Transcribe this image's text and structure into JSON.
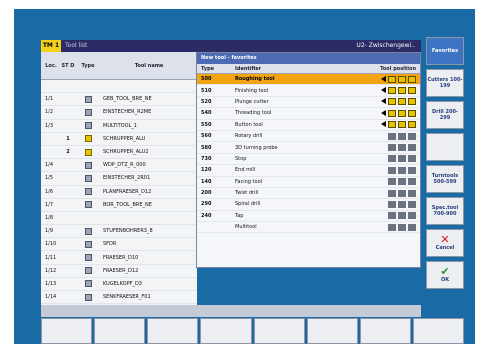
{
  "title_bar": {
    "badge": "TM 1",
    "label": "Tool list",
    "right_text": "U2- Zwischengewi.."
  },
  "main_list": {
    "headers": {
      "location": "Loc.",
      "no": "ST D",
      "type": "Type",
      "name": "Tool name"
    },
    "rows": [
      {
        "loc": "",
        "no": "",
        "type": "",
        "name": ""
      },
      {
        "loc": "1/1",
        "no": "",
        "type": "tool",
        "name": "GEB_TOOL_BRE_NE"
      },
      {
        "loc": "1/2",
        "no": "",
        "type": "tool",
        "name": "EINSTECHER_R2ME"
      },
      {
        "loc": "1/3",
        "no": "",
        "type": "tool",
        "name": "MULTITOOL_1"
      },
      {
        "loc": "",
        "no": "1",
        "type": "yellow",
        "name": "SCHRUPPER_ALU"
      },
      {
        "loc": "",
        "no": "2",
        "type": "yellow",
        "name": "SCHRUPPER_ALU2"
      },
      {
        "loc": "1/4",
        "no": "",
        "type": "tool",
        "name": "WDP_DTZ_R_000"
      },
      {
        "loc": "1/5",
        "no": "",
        "type": "tool",
        "name": "EINSTECHER_2R01"
      },
      {
        "loc": "1/6",
        "no": "",
        "type": "tool",
        "name": "PLANFRAESER_D12"
      },
      {
        "loc": "1/7",
        "no": "",
        "type": "tool",
        "name": "BOR_TOOL_BRE_NE"
      },
      {
        "loc": "1/8",
        "no": "",
        "type": "",
        "name": ""
      },
      {
        "loc": "1/9",
        "no": "",
        "type": "tool",
        "name": "STUFENBOHRER3_8"
      },
      {
        "loc": "1/10",
        "no": "",
        "type": "tool",
        "name": "SFDR"
      },
      {
        "loc": "1/11",
        "no": "",
        "type": "tool",
        "name": "FRAESER_D10"
      },
      {
        "loc": "1/12",
        "no": "",
        "type": "tool",
        "name": "FRAESER_D12"
      },
      {
        "loc": "1/13",
        "no": "",
        "type": "tool",
        "name": "KUGELKOPF_D3"
      },
      {
        "loc": "1/14",
        "no": "",
        "type": "tool",
        "name": "SENKFRAESER_F01"
      }
    ]
  },
  "popup": {
    "title": "New tool - favorites",
    "headers": {
      "type": "Type",
      "identifier": "Identifier",
      "tool_position": "Tool position"
    },
    "rows": [
      {
        "type": "500",
        "identifier": "Roughing tool",
        "selected": true
      },
      {
        "type": "510",
        "identifier": "Finishing tool",
        "selected": false
      },
      {
        "type": "520",
        "identifier": "Plunge cutter",
        "selected": false
      },
      {
        "type": "540",
        "identifier": "Threading tool",
        "selected": false
      },
      {
        "type": "550",
        "identifier": "Button tool",
        "selected": false
      },
      {
        "type": "560",
        "identifier": "Rotary drill",
        "selected": false
      },
      {
        "type": "580",
        "identifier": "3D turning probe",
        "selected": false
      },
      {
        "type": "730",
        "identifier": "Stop",
        "selected": false
      },
      {
        "type": "120",
        "identifier": "End mill",
        "selected": false
      },
      {
        "type": "140",
        "identifier": "Facing tool",
        "selected": false
      },
      {
        "type": "200",
        "identifier": "Twist drill",
        "selected": false
      },
      {
        "type": "290",
        "identifier": "Spiral drill",
        "selected": false
      },
      {
        "type": "240",
        "identifier": "Tap",
        "selected": false
      },
      {
        "type": "",
        "identifier": "Multitool",
        "selected": false
      }
    ]
  },
  "softkeys": {
    "favorites": "Favorites",
    "cutters": "Cutters 100-199",
    "drill": "Drill 200-299",
    "turntools": "Turntools 500-599",
    "special": "Spec.tool 700-900",
    "cancel": "Cancel",
    "ok": "OK"
  },
  "colors": {
    "accent": "#f3a413",
    "bezel": "#1a6aa6",
    "title_bar": "#2b2b66",
    "popup_title": "#4c6bb3"
  }
}
